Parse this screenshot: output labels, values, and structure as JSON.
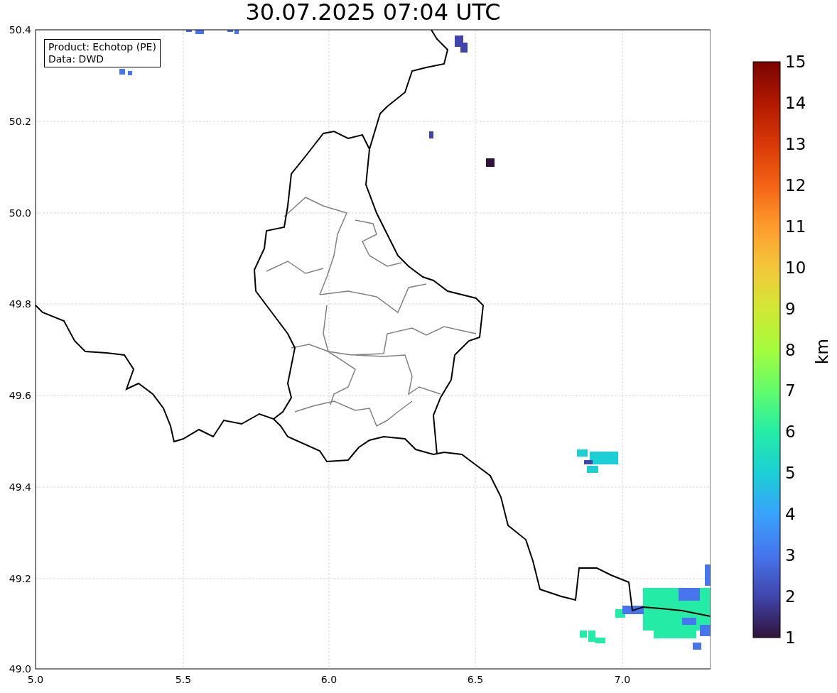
{
  "title": "30.07.2025 07:04 UTC",
  "info_box": [
    "Product: Echotop (PE)",
    "Data: DWD"
  ],
  "x_ticks": [
    "5.0",
    "5.5",
    "6.0",
    "6.5",
    "7.0"
  ],
  "y_ticks": [
    "50.4",
    "50.2",
    "50.0",
    "49.8",
    "49.6",
    "49.4",
    "49.2",
    "49.0"
  ],
  "colorbar": {
    "label": "km",
    "ticks": [
      "15",
      "14",
      "13",
      "12",
      "11",
      "10",
      "9",
      "8",
      "7",
      "6",
      "5",
      "4",
      "3",
      "2",
      "1"
    ]
  }
}
